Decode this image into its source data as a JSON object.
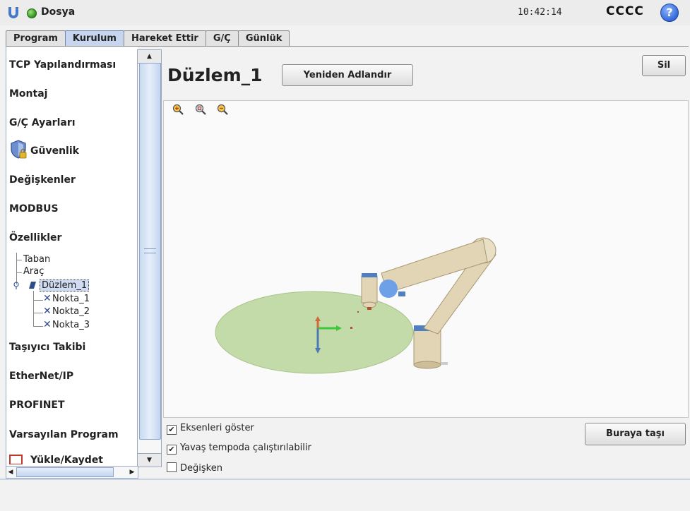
{
  "app": {
    "file_menu": "Dosya",
    "time": "10:42:14",
    "robot_name": "CCCC",
    "help_glyph": "?"
  },
  "tabs": [
    "Program",
    "Kurulum",
    "Hareket Ettir",
    "G/Ç",
    "Günlük"
  ],
  "sidebar": {
    "items": [
      "TCP Yapılandırması",
      "Montaj",
      "G/Ç Ayarları",
      "Güvenlik",
      "Değişkenler",
      "MODBUS",
      "Özellikler",
      "Taşıyıcı Takibi",
      "EtherNet/IP",
      "PROFINET",
      "Varsayılan Program",
      "Yükle/Kaydet"
    ],
    "tree": [
      "Taban",
      "Araç",
      "Düzlem_1",
      "Nokta_1",
      "Nokta_2",
      "Nokta_3"
    ]
  },
  "main": {
    "title": "Düzlem_1",
    "rename_label": "Yeniden Adlandır",
    "delete_label": "Sil",
    "move_here_label": "Buraya taşı",
    "checkboxes": [
      {
        "label": "Eksenleri göster",
        "checked": true
      },
      {
        "label": "Yavaş tempoda çalıştırılabilir",
        "checked": true
      },
      {
        "label": "Değişken",
        "checked": false
      }
    ]
  },
  "icons": [
    "ur-logo-icon",
    "status-ok-icon",
    "help-icon",
    "shield-lock-icon",
    "zoom-in-icon",
    "zoom-reset-icon",
    "zoom-out-icon",
    "plane-icon",
    "point-x-icon"
  ],
  "colors": {
    "tab_active": "#c7d6ee",
    "plane_fill": "#c3dba8",
    "robot_body": "#e2d5b5",
    "robot_joint": "#4f7fc0"
  }
}
